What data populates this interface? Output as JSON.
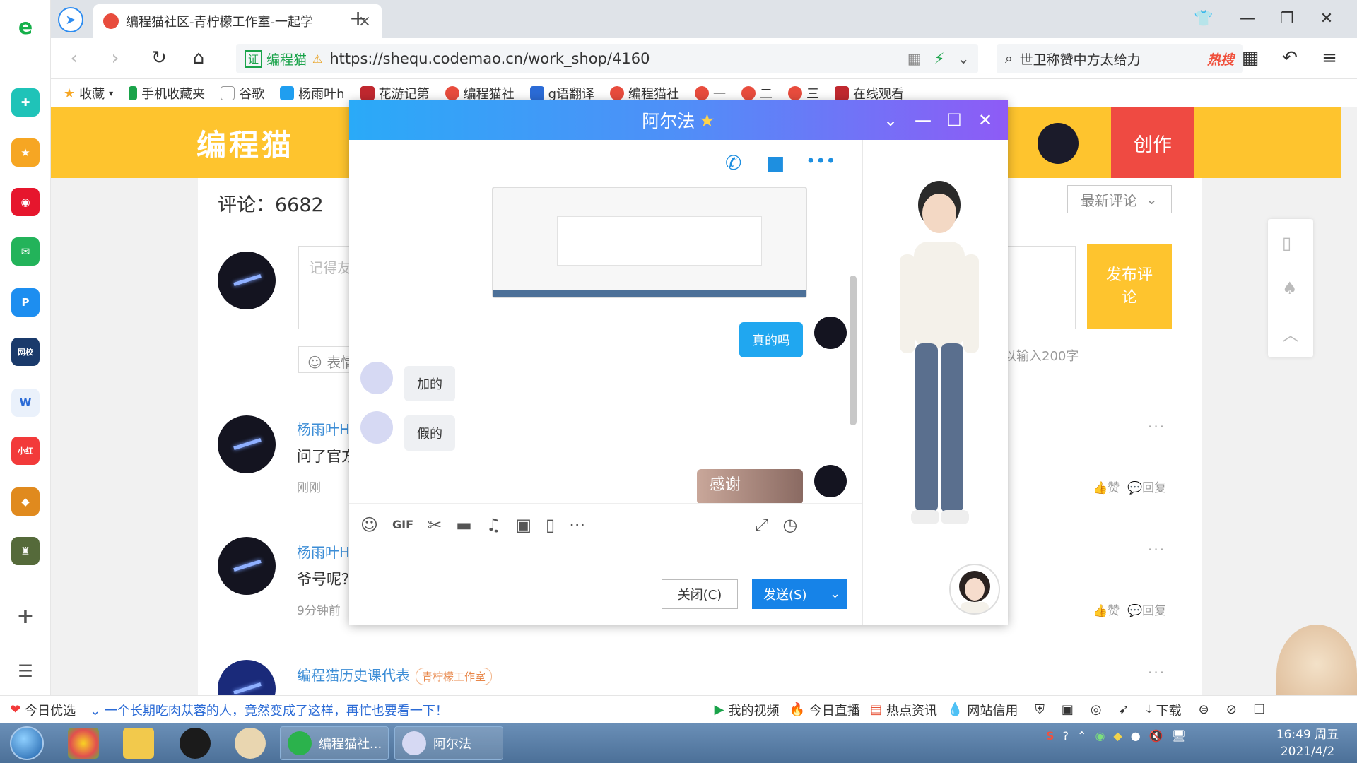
{
  "browser": {
    "tab_title": "编程猫社区-青柠檬工作室-一起学",
    "tab_close": "×",
    "new_tab": "+",
    "cert_label": "证",
    "site_name": "编程猫",
    "url": "https://sheq् qu.codemao.cn/work_shop/4160",
    "search_text": "世卫称赞中方太给力",
    "search_hot": "热搜"
  },
  "bookmarks": [
    {
      "label": "收藏"
    },
    {
      "label": "手机收藏夹"
    },
    {
      "label": "谷歌"
    },
    {
      "label": "杨雨叶h"
    },
    {
      "label": "花游记第"
    },
    {
      "label": "编程猫社"
    },
    {
      "label": "g语翻译"
    },
    {
      "label": "编程猫社"
    },
    {
      "label": "一"
    },
    {
      "label": "二"
    },
    {
      "label": "三"
    },
    {
      "label": "在线观看"
    }
  ],
  "site": {
    "brand": "编程猫",
    "create": "创作",
    "comment_count": "评论：6682",
    "sort": "最新评论",
    "comment_placeholder": "记得友",
    "emoji_btn": "表情",
    "publish": "发布评论",
    "limit": "以输入200字"
  },
  "comments": [
    {
      "name": "杨雨叶H",
      "text": "问了官方",
      "time": "刚刚",
      "like": "赞",
      "reply": "回复"
    },
    {
      "name": "杨雨叶H",
      "text": "爷号呢？",
      "time": "9分钟前",
      "like": "赞",
      "reply": "回复"
    },
    {
      "name": "编程猫历史课代表",
      "tag": "青柠檬工作室"
    }
  ],
  "chat": {
    "title": "阿尔法",
    "messages": [
      {
        "side": "right",
        "text": "真的吗"
      },
      {
        "side": "left",
        "text": "加的"
      },
      {
        "side": "left",
        "text": "假的"
      },
      {
        "side": "right",
        "text": "感谢"
      }
    ],
    "close_btn": "关闭(C)",
    "send_btn": "发送(S)"
  },
  "newsbar": {
    "today": "今日优选",
    "headline": "一个长期吃肉苁蓉的人，竟然变成了这样，再忙也要看一下！",
    "items": [
      "我的视频",
      "今日直播",
      "热点资讯",
      "网站信用"
    ],
    "download": "下载"
  },
  "taskbar": {
    "app1": "编程猫社...",
    "app2": "阿尔法",
    "time": "16:49 周五",
    "date": "2021/4/2"
  },
  "colors": {
    "brand_yellow": "#fec42e",
    "create_red": "#ef4a42",
    "chat_blue": "#20a7f0"
  }
}
